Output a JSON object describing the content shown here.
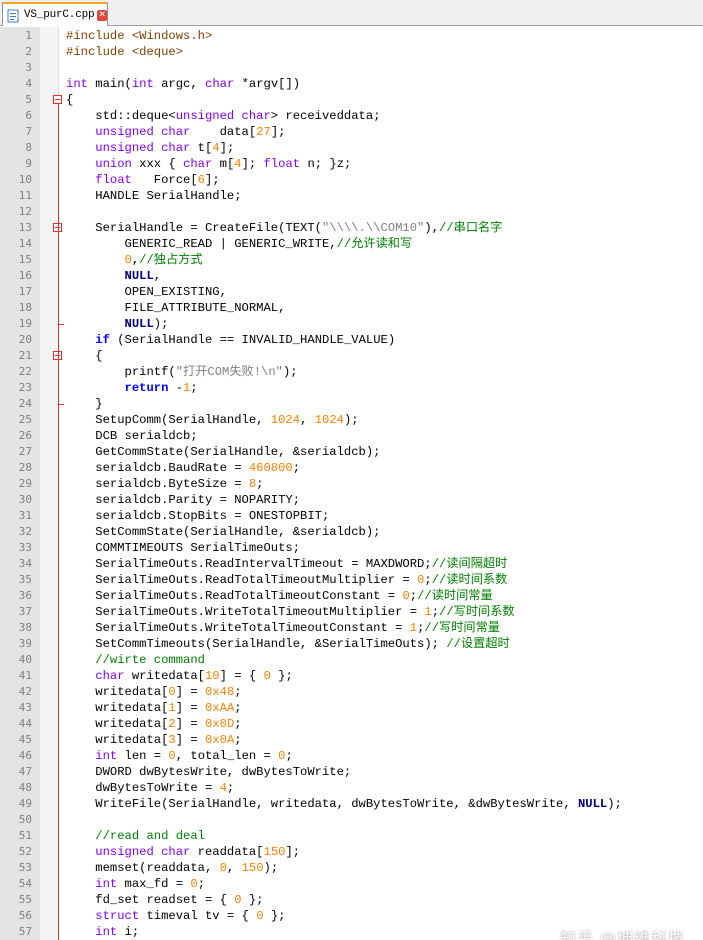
{
  "tab": {
    "filename": "VS_purC.cpp"
  },
  "colors": {
    "keyword": "#0000ff",
    "type": "#8000ff",
    "number": "#ff8000",
    "string": "#808080",
    "comment": "#008000",
    "preprocessor": "#804000",
    "fold": "#e03030",
    "tab_accent": "#f6a327"
  },
  "lines": [
    [
      [
        "pp",
        "#include <Windows.h>"
      ]
    ],
    [
      [
        "pp",
        "#include <deque>"
      ]
    ],
    [],
    [
      [
        "typ",
        "int"
      ],
      [
        "",
        "main("
      ],
      [
        "typ",
        "int"
      ],
      [
        "",
        "argc, "
      ],
      [
        "typ",
        "char"
      ],
      [
        "",
        "*argv[])"
      ]
    ],
    [
      [
        "",
        "{"
      ]
    ],
    [
      [
        "",
        "    std::deque<"
      ],
      [
        "typ",
        "unsigned char"
      ],
      [
        "",
        "> receiveddata;"
      ]
    ],
    [
      [
        "",
        "    "
      ],
      [
        "typ",
        "unsigned char"
      ],
      [
        "",
        "    data["
      ],
      [
        "num",
        "27"
      ],
      [
        "",
        "];"
      ]
    ],
    [
      [
        "",
        "    "
      ],
      [
        "typ",
        "unsigned char"
      ],
      [
        "",
        "t["
      ],
      [
        "num",
        "4"
      ],
      [
        "",
        "];"
      ]
    ],
    [
      [
        "",
        "    "
      ],
      [
        "typ",
        "union"
      ],
      [
        "",
        "xxx { "
      ],
      [
        "typ",
        "char"
      ],
      [
        "",
        "m["
      ],
      [
        "num",
        "4"
      ],
      [
        "",
        "]; "
      ],
      [
        "typ",
        "float"
      ],
      [
        "",
        "n; }z;"
      ]
    ],
    [
      [
        "",
        "    "
      ],
      [
        "typ",
        "float"
      ],
      [
        "",
        "   Force["
      ],
      [
        "num",
        "6"
      ],
      [
        "",
        "];"
      ]
    ],
    [
      [
        "",
        "    HANDLE SerialHandle;"
      ]
    ],
    [],
    [
      [
        "",
        "    SerialHandle = CreateFile(TEXT("
      ],
      [
        "str",
        "\"\\\\\\\\.\\\\COM10\""
      ],
      [
        "",
        "),"
      ],
      [
        "cmt",
        "//串口名字"
      ]
    ],
    [
      [
        "",
        "        GENERIC_READ | GENERIC_WRITE,"
      ],
      [
        "cmt",
        "//允许读和写"
      ]
    ],
    [
      [
        "",
        "        "
      ],
      [
        "num",
        "0"
      ],
      [
        "",
        ","
      ],
      [
        "cmt",
        "//独占方式"
      ]
    ],
    [
      [
        "",
        "        "
      ],
      [
        "op",
        "NULL"
      ],
      [
        "",
        ","
      ]
    ],
    [
      [
        "",
        "        OPEN_EXISTING,"
      ]
    ],
    [
      [
        "",
        "        FILE_ATTRIBUTE_NORMAL,"
      ]
    ],
    [
      [
        "",
        "        "
      ],
      [
        "op",
        "NULL"
      ],
      [
        "",
        ");"
      ]
    ],
    [
      [
        "",
        "    "
      ],
      [
        "kw",
        "if"
      ],
      [
        "",
        " (SerialHandle == INVALID_HANDLE_VALUE)"
      ]
    ],
    [
      [
        "",
        "    {"
      ]
    ],
    [
      [
        "",
        "        printf("
      ],
      [
        "str",
        "\"打开COM失败!\\n\""
      ],
      [
        "",
        ");"
      ]
    ],
    [
      [
        "",
        "        "
      ],
      [
        "kw",
        "return"
      ],
      [
        "",
        " -"
      ],
      [
        "num",
        "1"
      ],
      [
        "",
        ";"
      ]
    ],
    [
      [
        "",
        "    }"
      ]
    ],
    [
      [
        "",
        "    SetupComm(SerialHandle, "
      ],
      [
        "num",
        "1024"
      ],
      [
        "",
        ", "
      ],
      [
        "num",
        "1024"
      ],
      [
        "",
        ");"
      ]
    ],
    [
      [
        "",
        "    DCB serialdcb;"
      ]
    ],
    [
      [
        "",
        "    GetCommState(SerialHandle, &serialdcb);"
      ]
    ],
    [
      [
        "",
        "    serialdcb.BaudRate = "
      ],
      [
        "num",
        "460800"
      ],
      [
        "",
        ";"
      ]
    ],
    [
      [
        "",
        "    serialdcb.ByteSize = "
      ],
      [
        "num",
        "8"
      ],
      [
        "",
        ";"
      ]
    ],
    [
      [
        "",
        "    serialdcb.Parity = NOPARITY;"
      ]
    ],
    [
      [
        "",
        "    serialdcb.StopBits = ONESTOPBIT;"
      ]
    ],
    [
      [
        "",
        "    SetCommState(SerialHandle, &serialdcb);"
      ]
    ],
    [
      [
        "",
        "    COMMTIMEOUTS SerialTimeOuts;"
      ]
    ],
    [
      [
        "",
        "    SerialTimeOuts.ReadIntervalTimeout = MAXDWORD;"
      ],
      [
        "cmt",
        "//读间隔超时"
      ]
    ],
    [
      [
        "",
        "    SerialTimeOuts.ReadTotalTimeoutMultiplier = "
      ],
      [
        "num",
        "0"
      ],
      [
        "",
        ";"
      ],
      [
        "cmt",
        "//读时间系数"
      ]
    ],
    [
      [
        "",
        "    SerialTimeOuts.ReadTotalTimeoutConstant = "
      ],
      [
        "num",
        "0"
      ],
      [
        "",
        ";"
      ],
      [
        "cmt",
        "//读时间常量"
      ]
    ],
    [
      [
        "",
        "    SerialTimeOuts.WriteTotalTimeoutMultiplier = "
      ],
      [
        "num",
        "1"
      ],
      [
        "",
        ";"
      ],
      [
        "cmt",
        "//写时间系数"
      ]
    ],
    [
      [
        "",
        "    SerialTimeOuts.WriteTotalTimeoutConstant = "
      ],
      [
        "num",
        "1"
      ],
      [
        "",
        ";"
      ],
      [
        "cmt",
        "//写时间常量"
      ]
    ],
    [
      [
        "",
        "    SetCommTimeouts(SerialHandle, &SerialTimeOuts); "
      ],
      [
        "cmt",
        "//设置超时"
      ]
    ],
    [
      [
        "",
        "    "
      ],
      [
        "cmt",
        "//wirte command"
      ]
    ],
    [
      [
        "",
        "    "
      ],
      [
        "typ",
        "char"
      ],
      [
        "",
        "writedata["
      ],
      [
        "num",
        "10"
      ],
      [
        "",
        "] = { "
      ],
      [
        "num",
        "0"
      ],
      [
        "",
        " };"
      ]
    ],
    [
      [
        "",
        "    writedata["
      ],
      [
        "num",
        "0"
      ],
      [
        "",
        "] = "
      ],
      [
        "num",
        "0x48"
      ],
      [
        "",
        ";"
      ]
    ],
    [
      [
        "",
        "    writedata["
      ],
      [
        "num",
        "1"
      ],
      [
        "",
        "] = "
      ],
      [
        "num",
        "0xAA"
      ],
      [
        "",
        ";"
      ]
    ],
    [
      [
        "",
        "    writedata["
      ],
      [
        "num",
        "2"
      ],
      [
        "",
        "] = "
      ],
      [
        "num",
        "0x0D"
      ],
      [
        "",
        ";"
      ]
    ],
    [
      [
        "",
        "    writedata["
      ],
      [
        "num",
        "3"
      ],
      [
        "",
        "] = "
      ],
      [
        "num",
        "0x0A"
      ],
      [
        "",
        ";"
      ]
    ],
    [
      [
        "",
        "    "
      ],
      [
        "typ",
        "int"
      ],
      [
        "",
        "len = "
      ],
      [
        "num",
        "0"
      ],
      [
        "",
        ", total_len = "
      ],
      [
        "num",
        "0"
      ],
      [
        "",
        ";"
      ]
    ],
    [
      [
        "",
        "    DWORD dwBytesWrite, dwBytesToWrite;"
      ]
    ],
    [
      [
        "",
        "    dwBytesToWrite = "
      ],
      [
        "num",
        "4"
      ],
      [
        "",
        ";"
      ]
    ],
    [
      [
        "",
        "    WriteFile(SerialHandle, writedata, dwBytesToWrite, &dwBytesWrite, "
      ],
      [
        "op",
        "NULL"
      ],
      [
        "",
        ");"
      ]
    ],
    [],
    [
      [
        "",
        "    "
      ],
      [
        "cmt",
        "//read and deal"
      ]
    ],
    [
      [
        "",
        "    "
      ],
      [
        "typ",
        "unsigned char"
      ],
      [
        "",
        "readdata["
      ],
      [
        "num",
        "150"
      ],
      [
        "",
        "];"
      ]
    ],
    [
      [
        "",
        "    memset(readdata, "
      ],
      [
        "num",
        "0"
      ],
      [
        "",
        ", "
      ],
      [
        "num",
        "150"
      ],
      [
        "",
        ");"
      ]
    ],
    [
      [
        "",
        "    "
      ],
      [
        "typ",
        "int"
      ],
      [
        "",
        "max_fd = "
      ],
      [
        "num",
        "0"
      ],
      [
        "",
        ";"
      ]
    ],
    [
      [
        "",
        "    fd_set readset = { "
      ],
      [
        "num",
        "0"
      ],
      [
        "",
        " };"
      ]
    ],
    [
      [
        "",
        "    "
      ],
      [
        "typ",
        "struct"
      ],
      [
        "",
        "timeval tv = { "
      ],
      [
        "num",
        "0"
      ],
      [
        "",
        " };"
      ]
    ],
    [
      [
        "",
        "    "
      ],
      [
        "typ",
        "int"
      ],
      [
        "",
        "i;"
      ]
    ]
  ],
  "watermark": "知乎 @坤维科技"
}
